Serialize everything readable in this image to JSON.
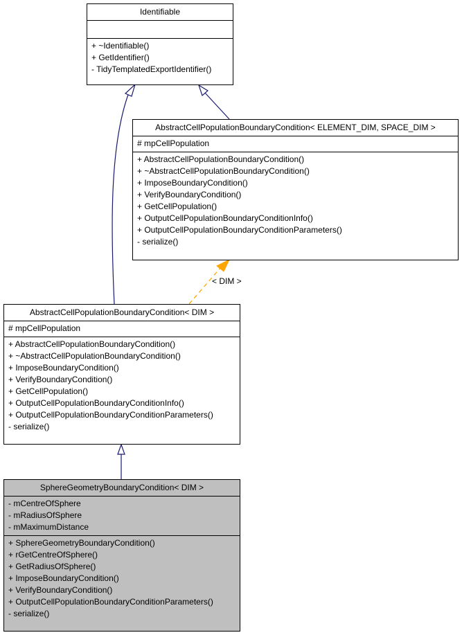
{
  "classes": {
    "identifiable": {
      "name": "Identifiable",
      "attributes": [],
      "methods": [
        "+ ~Identifiable()",
        "+ GetIdentifier()",
        "- TidyTemplatedExportIdentifier()"
      ]
    },
    "abstract_template": {
      "name": "AbstractCellPopulationBoundaryCondition< ELEMENT_DIM, SPACE_DIM >",
      "attributes": [
        "# mpCellPopulation"
      ],
      "methods": [
        "+ AbstractCellPopulationBoundaryCondition()",
        "+ ~AbstractCellPopulationBoundaryCondition()",
        "+ ImposeBoundaryCondition()",
        "+ VerifyBoundaryCondition()",
        "+ GetCellPopulation()",
        "+ OutputCellPopulationBoundaryConditionInfo()",
        "+ OutputCellPopulationBoundaryConditionParameters()",
        "- serialize()"
      ]
    },
    "abstract_dim": {
      "name": "AbstractCellPopulationBoundaryCondition< DIM >",
      "attributes": [
        "# mpCellPopulation"
      ],
      "methods": [
        "+ AbstractCellPopulationBoundaryCondition()",
        "+ ~AbstractCellPopulationBoundaryCondition()",
        "+ ImposeBoundaryCondition()",
        "+ VerifyBoundaryCondition()",
        "+ GetCellPopulation()",
        "+ OutputCellPopulationBoundaryConditionInfo()",
        "+ OutputCellPopulationBoundaryConditionParameters()",
        "- serialize()"
      ]
    },
    "sphere": {
      "name": "SphereGeometryBoundaryCondition< DIM >",
      "attributes": [
        "- mCentreOfSphere",
        "- mRadiusOfSphere",
        "- mMaximumDistance"
      ],
      "methods": [
        "+ SphereGeometryBoundaryCondition()",
        "+ rGetCentreOfSphere()",
        "+ GetRadiusOfSphere()",
        "+ ImposeBoundaryCondition()",
        "+ VerifyBoundaryCondition()",
        "+ OutputCellPopulationBoundaryConditionParameters()",
        "- serialize()"
      ]
    }
  },
  "edges": {
    "template_label": "< DIM >",
    "inheritance_color": "#191970",
    "template_color": "#ffa500"
  }
}
